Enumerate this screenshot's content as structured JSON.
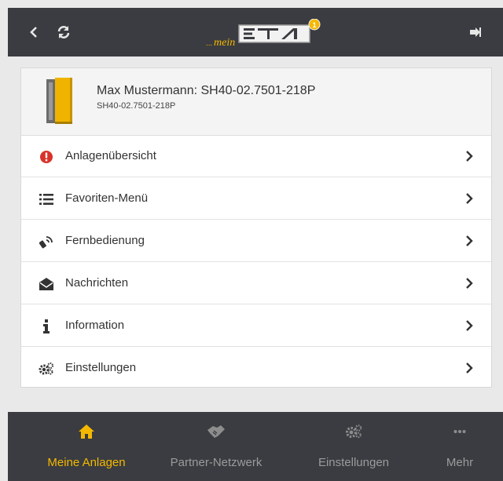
{
  "header": {
    "logo_prefix": "mein",
    "logo_text": "ETA",
    "logo_badge": "1"
  },
  "device": {
    "name": "Max Mustermann: SH40-02.7501-218P",
    "id": "SH40-02.7501-218P"
  },
  "menu": [
    {
      "label": "Anlagenübersicht",
      "icon": "alert-circle-icon"
    },
    {
      "label": "Favoriten-Menü",
      "icon": "list-icon"
    },
    {
      "label": "Fernbedienung",
      "icon": "remote-signal-icon"
    },
    {
      "label": "Nachrichten",
      "icon": "envelope-open-icon"
    },
    {
      "label": "Information",
      "icon": "info-icon"
    },
    {
      "label": "Einstellungen",
      "icon": "cogs-icon"
    }
  ],
  "bottom_nav": [
    {
      "label": "Meine Anlagen",
      "icon": "home-icon",
      "active": true
    },
    {
      "label": "Partner-Netzwerk",
      "icon": "handshake-icon",
      "active": false
    },
    {
      "label": "Einstellungen",
      "icon": "cogs-icon",
      "active": false
    },
    {
      "label": "Mehr",
      "icon": "more-dots-icon",
      "active": false
    }
  ],
  "colors": {
    "bar_bg": "#3a3c41",
    "accent": "#f5b800",
    "alert": "#d9322b"
  }
}
